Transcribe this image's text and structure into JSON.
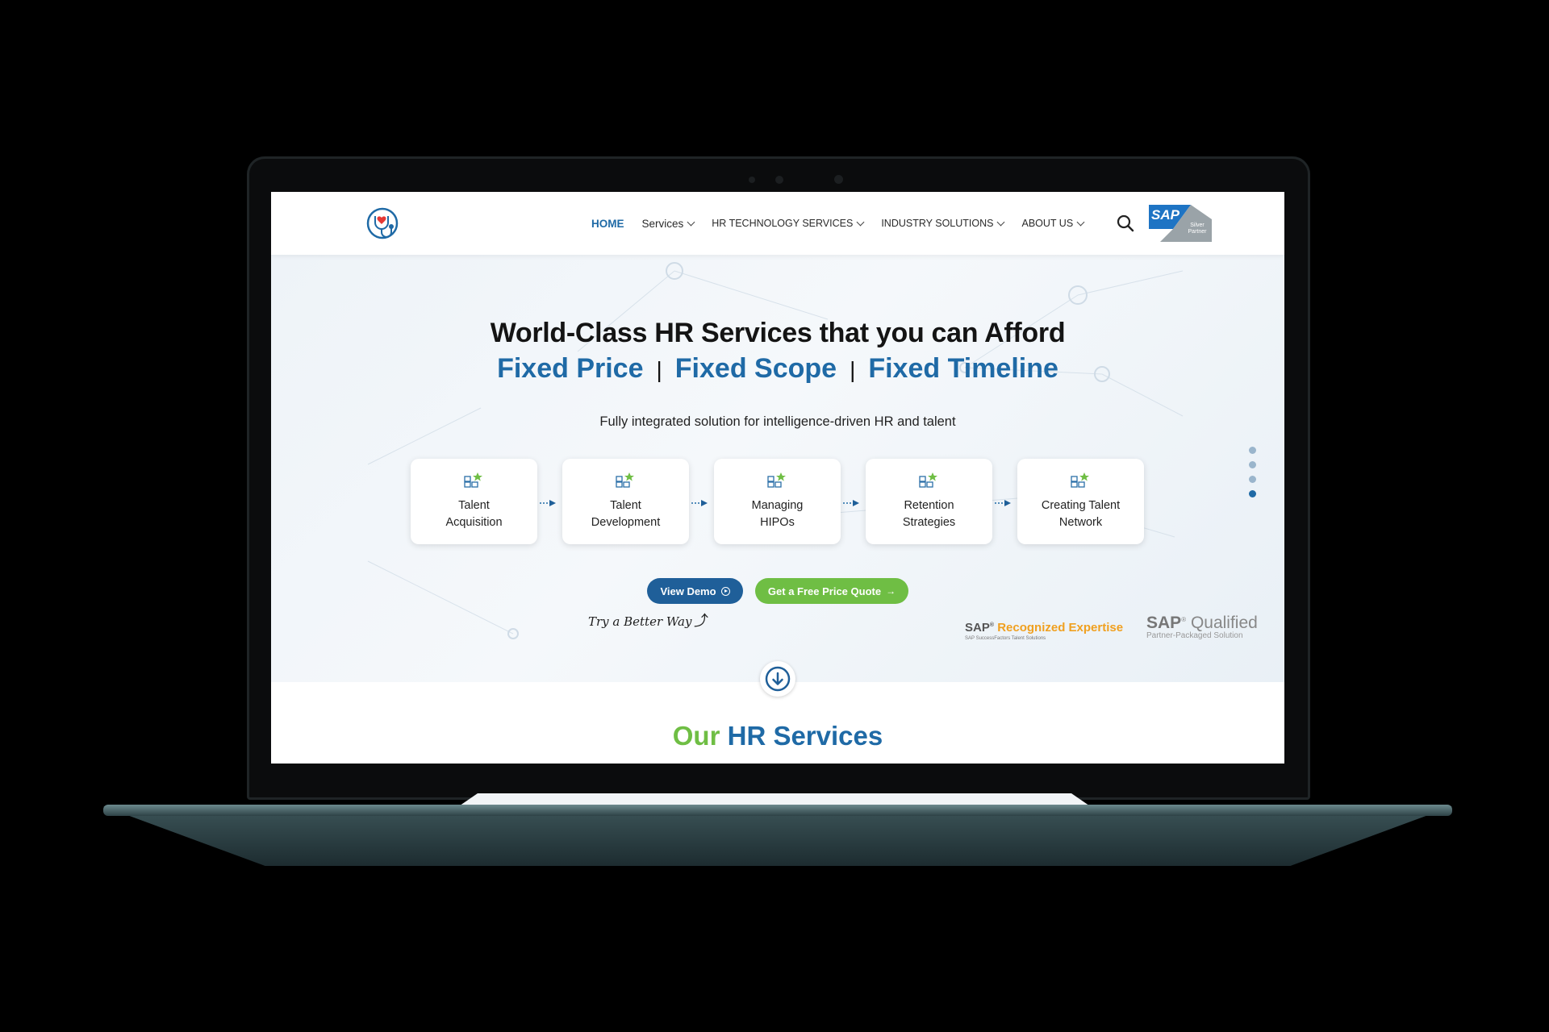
{
  "nav": {
    "home": "HOME",
    "services": "Services",
    "hr_tech": "HR TECHNOLOGY SERVICES",
    "industry": "INDUSTRY SOLUTIONS",
    "about": "ABOUT US"
  },
  "sap_badge": {
    "text": "SAP",
    "tier": "Silver Partner"
  },
  "hero": {
    "title": "World-Class HR Services that you can Afford",
    "sub1": "Fixed Price",
    "sub2": "Fixed Scope",
    "sub3": "Fixed Timeline",
    "separator": "|",
    "tagline": "Fully integrated solution for intelligence-driven HR and talent"
  },
  "steps": [
    {
      "label": "Talent\nAcquisition"
    },
    {
      "label": "Talent\nDevelopment"
    },
    {
      "label": "Managing\nHIPOs"
    },
    {
      "label": "Retention\nStrategies"
    },
    {
      "label": "Creating Talent\nNetwork"
    }
  ],
  "buttons": {
    "demo": "View Demo",
    "quote": "Get a Free Price Quote"
  },
  "try_text": "Try a Better Way",
  "sap_recognized": {
    "brand": "SAP",
    "text": "Recognized Expertise",
    "sub": "SAP SuccessFactors Talent Solutions"
  },
  "sap_qualified": {
    "brand": "SAP",
    "text": "Qualified",
    "sub": "Partner-Packaged Solution"
  },
  "section": {
    "green": "Our",
    "blue": "HR Services"
  },
  "icons": [
    "logo-icon",
    "search-icon",
    "chevron-down-icon",
    "grid-star-icon",
    "arrow-right-icon",
    "arrow-down-circle-icon"
  ],
  "colors": {
    "brand_blue": "#1f6aa6",
    "brand_green": "#6fbe44",
    "demo_button": "#1f5f99"
  },
  "carousel": {
    "slides": 4,
    "active": 4
  }
}
